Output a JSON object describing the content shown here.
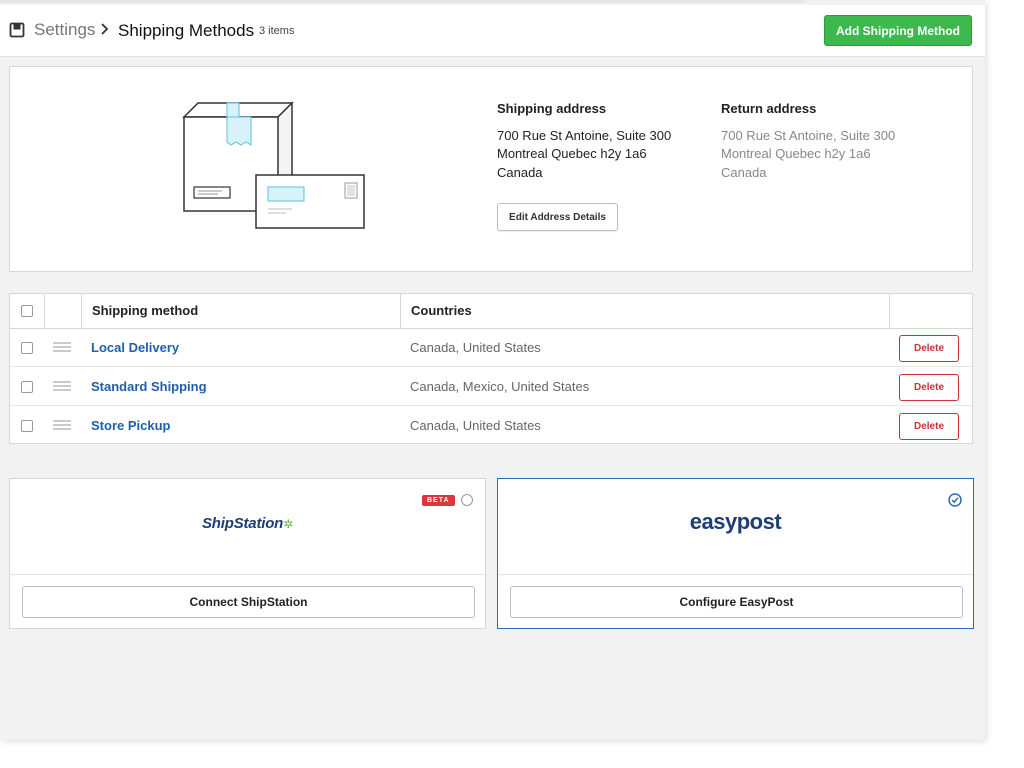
{
  "header": {
    "breadcrumb_root": "Settings",
    "title": "Shipping Methods",
    "count": "3 items",
    "add_button": "Add Shipping Method"
  },
  "address": {
    "shipping": {
      "heading": "Shipping address",
      "line1": "700 Rue St Antoine, Suite 300",
      "line2": "Montreal Quebec h2y 1a6",
      "line3": "Canada"
    },
    "return": {
      "heading": "Return address",
      "line1": "700 Rue St Antoine, Suite 300",
      "line2": "Montreal Quebec h2y 1a6",
      "line3": "Canada"
    },
    "edit_button": "Edit Address Details"
  },
  "table": {
    "columns": [
      "Shipping method",
      "Countries"
    ],
    "rows": [
      {
        "name": "Local Delivery",
        "countries": "Canada, United States",
        "action": "Delete"
      },
      {
        "name": "Standard Shipping",
        "countries": "Canada, Mexico, United States",
        "action": "Delete"
      },
      {
        "name": "Store Pickup",
        "countries": "Canada, United States",
        "action": "Delete"
      }
    ]
  },
  "providers": [
    {
      "logo": "ShipStation",
      "badge": "BETA",
      "button": "Connect ShipStation",
      "selected": false
    },
    {
      "logo": "easypost",
      "button": "Configure EasyPost",
      "selected": true
    }
  ],
  "icons": {
    "header": "book-icon",
    "breadcrumb_separator": "chevron-right-icon",
    "row_handle": "drag-handle-icon",
    "selected_provider": "check-circle-icon"
  },
  "colors": {
    "primary_green": "#3cb84d",
    "link_blue": "#1f5fad",
    "danger_red": "#c8323a",
    "selected_border": "#2a6bb8"
  }
}
